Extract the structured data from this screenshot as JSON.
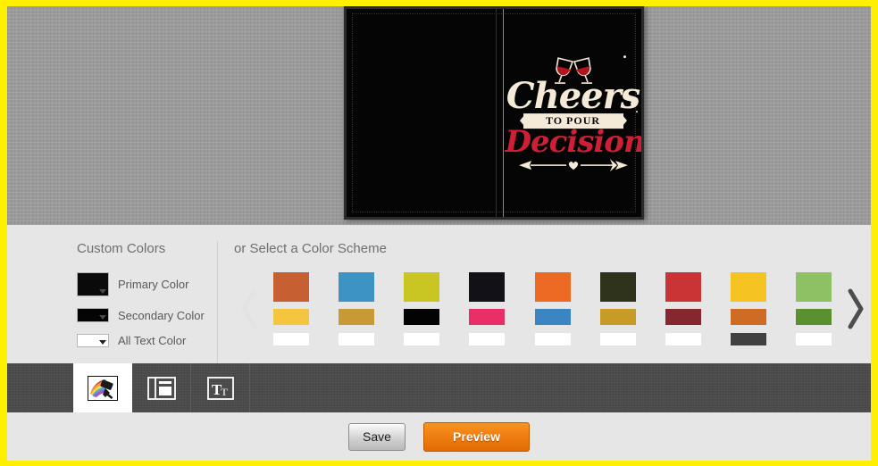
{
  "theme": {
    "border_color": "#ffef00",
    "stage_bg": "#9a9a9a",
    "panel_bg": "#e6e6e6",
    "tabbar_bg": "#4b4b4b",
    "preview_accent": "#ef7c10"
  },
  "preview": {
    "card_background": "#050505",
    "spine_color": "#7a0d14",
    "artwork": {
      "line1": "Cheers",
      "line2": "TO POUR",
      "line3": "Decisions",
      "line1_color": "#f5ead7",
      "line2_color": "#0a0a0a",
      "line3_color": "#cf1f35",
      "wine_color": "#b3151f"
    }
  },
  "custom_colors": {
    "title": "Custom Colors",
    "items": [
      {
        "label": "Primary Color",
        "value": "#0a0a0a"
      },
      {
        "label": "Secondary Color",
        "value": "#050505"
      },
      {
        "label": "All Text Color",
        "value": "#ffffff"
      }
    ]
  },
  "schemes": {
    "title": "or Select a Color Scheme",
    "prev_label": "Previous schemes",
    "next_label": "Next schemes",
    "items": [
      {
        "top": "#c65f31",
        "mid": "#f4c63f",
        "bottom": "#ffffff"
      },
      {
        "top": "#3d94c4",
        "mid": "#c99a33",
        "bottom": "#ffffff"
      },
      {
        "top": "#c9c523",
        "mid": "#030303",
        "bottom": "#ffffff"
      },
      {
        "top": "#131118",
        "mid": "#e92f67",
        "bottom": "#ffffff"
      },
      {
        "top": "#ec6a23",
        "mid": "#3b85c2",
        "bottom": "#ffffff"
      },
      {
        "top": "#2f331c",
        "mid": "#c79b25",
        "bottom": "#ffffff"
      },
      {
        "top": "#cb3434",
        "mid": "#85272f",
        "bottom": "#ffffff"
      },
      {
        "top": "#f5c322",
        "mid": "#cd6c22",
        "bottom": "#414141"
      },
      {
        "top": "#8dc163",
        "mid": "#5a9130",
        "bottom": "#ffffff"
      }
    ]
  },
  "tabs": [
    {
      "name": "design-colors",
      "icon": "paint-roller-icon",
      "active": true
    },
    {
      "name": "layout",
      "icon": "layout-icon",
      "active": false
    },
    {
      "name": "text",
      "icon": "text-icon",
      "active": false
    }
  ],
  "footer": {
    "save_label": "Save",
    "preview_label": "Preview"
  }
}
